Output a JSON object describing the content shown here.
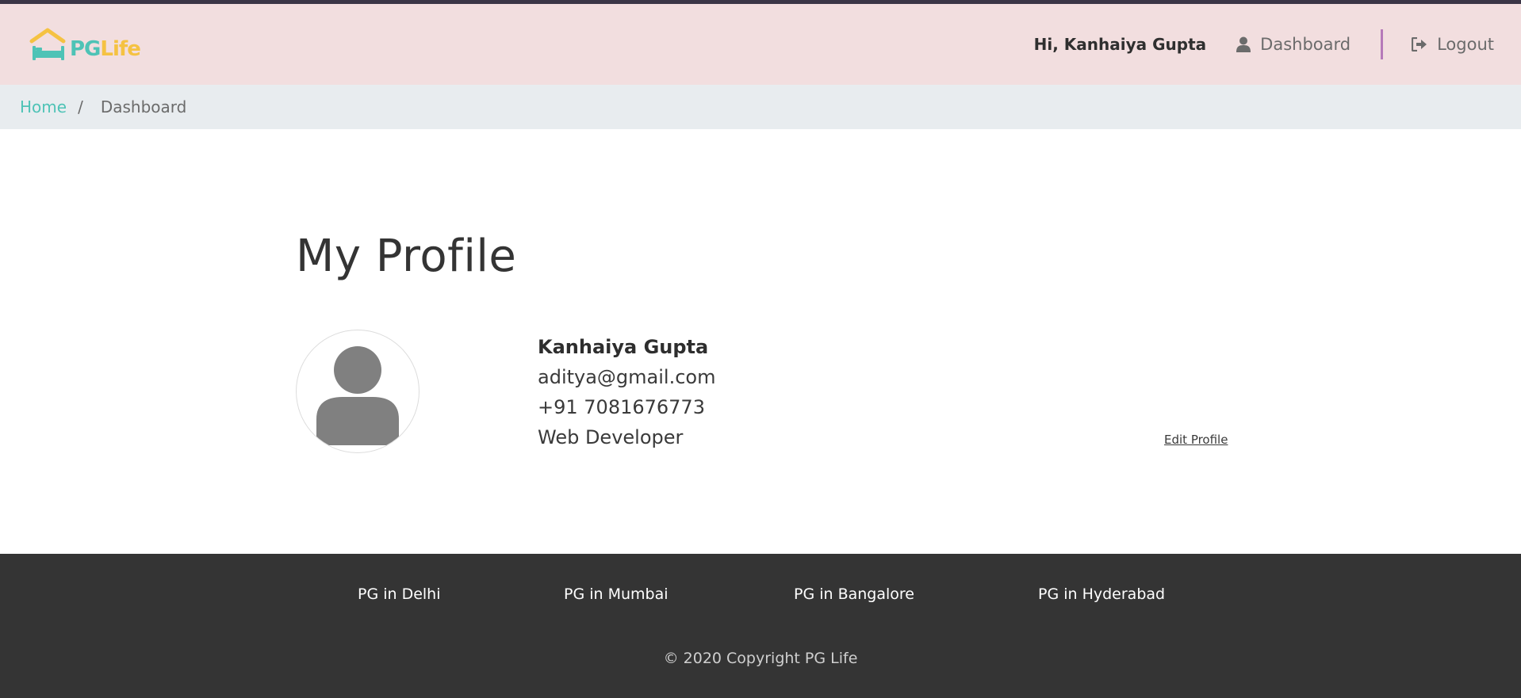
{
  "brand": {
    "logo_parts": [
      "PG",
      "Life"
    ],
    "colors": {
      "teal": "#4ec3b6",
      "yellow": "#f5c242",
      "nav_bg": "#f2dedf",
      "divider": "#b67ab9",
      "footer_bg": "#343434"
    }
  },
  "nav": {
    "greeting": "Hi, Kanhaiya Gupta",
    "dashboard_label": "Dashboard",
    "dashboard_icon": "user-icon",
    "logout_label": "Logout",
    "logout_icon": "sign-out-icon"
  },
  "breadcrumb": {
    "home": "Home",
    "separator": "/",
    "current": "Dashboard"
  },
  "profile": {
    "title": "My Profile",
    "avatar_icon": "user-avatar-icon",
    "name": "Kanhaiya Gupta",
    "email": "aditya@gmail.com",
    "phone": "+91 7081676773",
    "occupation": "Web Developer",
    "edit_label": "Edit Profile"
  },
  "footer": {
    "links": [
      "PG in Delhi",
      "PG in Mumbai",
      "PG in Bangalore",
      "PG in Hyderabad"
    ],
    "copyright": "© 2020 Copyright PG Life"
  }
}
